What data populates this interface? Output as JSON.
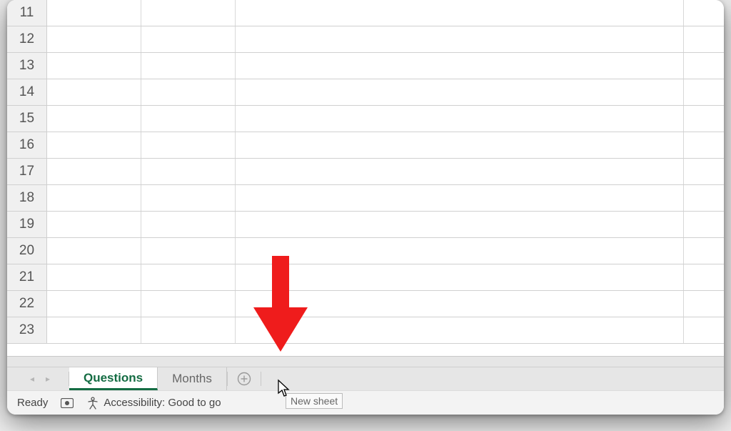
{
  "rows": [
    "11",
    "12",
    "13",
    "14",
    "15",
    "16",
    "17",
    "18",
    "19",
    "20",
    "21",
    "22",
    "23"
  ],
  "nav": {
    "prev": "◂",
    "next": "▸"
  },
  "tabs": [
    {
      "label": "Questions",
      "active": true
    },
    {
      "label": "Months",
      "active": false
    }
  ],
  "new_sheet_tooltip": "New sheet",
  "status": {
    "ready": "Ready",
    "accessibility": "Accessibility: Good to go"
  },
  "annotation": {
    "arrow_color": "#ef1c1c"
  }
}
